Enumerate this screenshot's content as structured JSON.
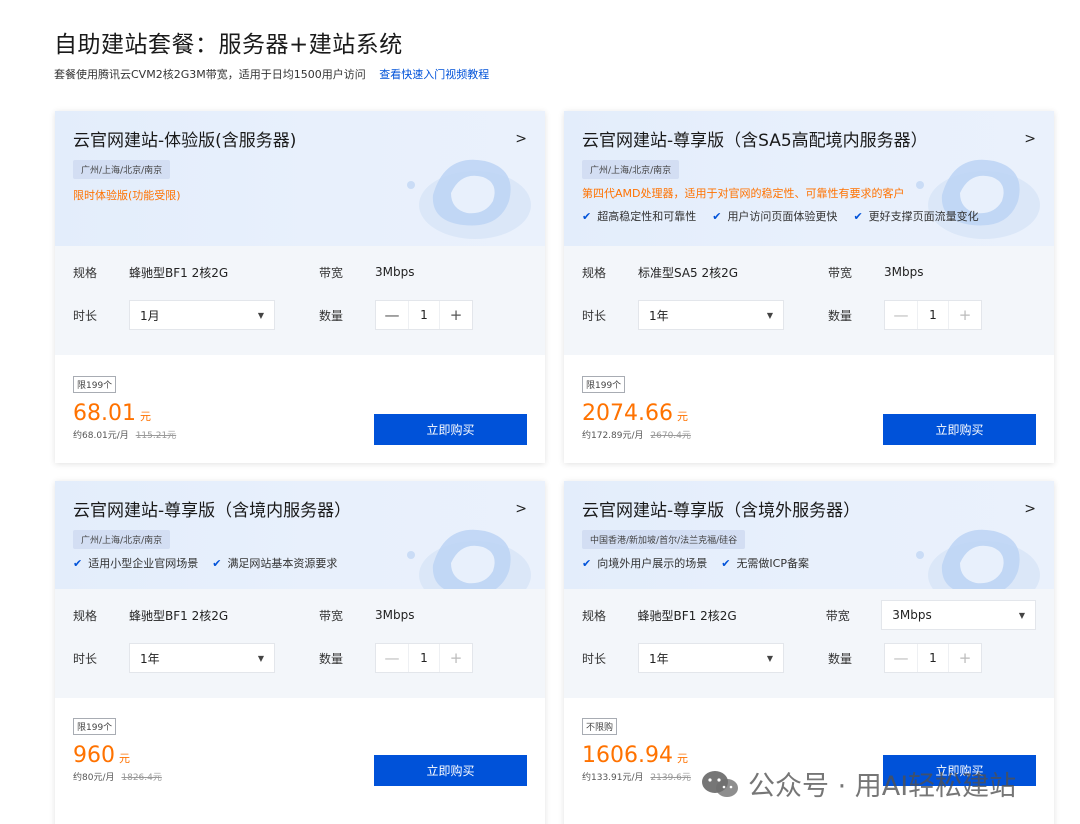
{
  "page": {
    "title": "自助建站套餐：服务器+建站系统",
    "subtitle": "套餐使用腾讯云CVM2核2G3M带宽，适用于日均1500用户访问",
    "tutorial_link": "查看快速入门视频教程"
  },
  "labels": {
    "spec": "规格",
    "bandwidth": "带宽",
    "duration": "时长",
    "quantity": "数量",
    "buy": "立即购买",
    "chevron": ">",
    "minus": "—",
    "plus": "+"
  },
  "colors": {
    "accent": "#0052d9",
    "price": "#ff7200"
  },
  "icons": {
    "check": "check-icon",
    "select": "chevron-down-icon",
    "wechat": "wechat-icon"
  },
  "cards": [
    {
      "title": "云官网建站-体验版(含服务器)",
      "region": "广州/上海/北京/南京",
      "promo": "限时体验版(功能受限)",
      "features": [],
      "spec_value": "蜂驰型BF1 2核2G",
      "bandwidth_value": "3Mbps",
      "duration_value": "1月",
      "quantity_value": "1",
      "limit": "限199个",
      "price": "68.01",
      "price_unit": "元",
      "monthly": "约68.01元/月",
      "original": "115.21元"
    },
    {
      "title": "云官网建站-尊享版（含SA5高配境内服务器）",
      "region": "广州/上海/北京/南京",
      "promo": "第四代AMD处理器，适用于对官网的稳定性、可靠性有要求的客户",
      "features": [
        "超高稳定性和可靠性",
        "用户访问页面体验更快",
        "更好支撑页面流量变化"
      ],
      "spec_value": "标准型SA5 2核2G",
      "bandwidth_value": "3Mbps",
      "duration_value": "1年",
      "quantity_value": "1",
      "limit": "限199个",
      "price": "2074.66",
      "price_unit": "元",
      "monthly": "约172.89元/月",
      "original": "2670.4元"
    },
    {
      "title": "云官网建站-尊享版（含境内服务器）",
      "region": "广州/上海/北京/南京",
      "promo": "",
      "features": [
        "适用小型企业官网场景",
        "满足网站基本资源要求"
      ],
      "spec_value": "蜂驰型BF1 2核2G",
      "bandwidth_value": "3Mbps",
      "duration_value": "1年",
      "quantity_value": "1",
      "limit": "限199个",
      "price": "960",
      "price_unit": "元",
      "monthly": "约80元/月",
      "original": "1826.4元"
    },
    {
      "title": "云官网建站-尊享版（含境外服务器）",
      "region": "中国香港/新加坡/首尔/法兰克福/硅谷",
      "promo": "",
      "features": [
        "向境外用户展示的场景",
        "无需做ICP备案"
      ],
      "spec_value": "蜂驰型BF1 2核2G",
      "bandwidth_value": "3Mbps",
      "duration_value": "1年",
      "quantity_value": "1",
      "limit": "不限购",
      "price": "1606.94",
      "price_unit": "元",
      "monthly": "约133.91元/月",
      "original": "2139.6元"
    }
  ],
  "watermark": "公众号 · 用AI轻松建站"
}
